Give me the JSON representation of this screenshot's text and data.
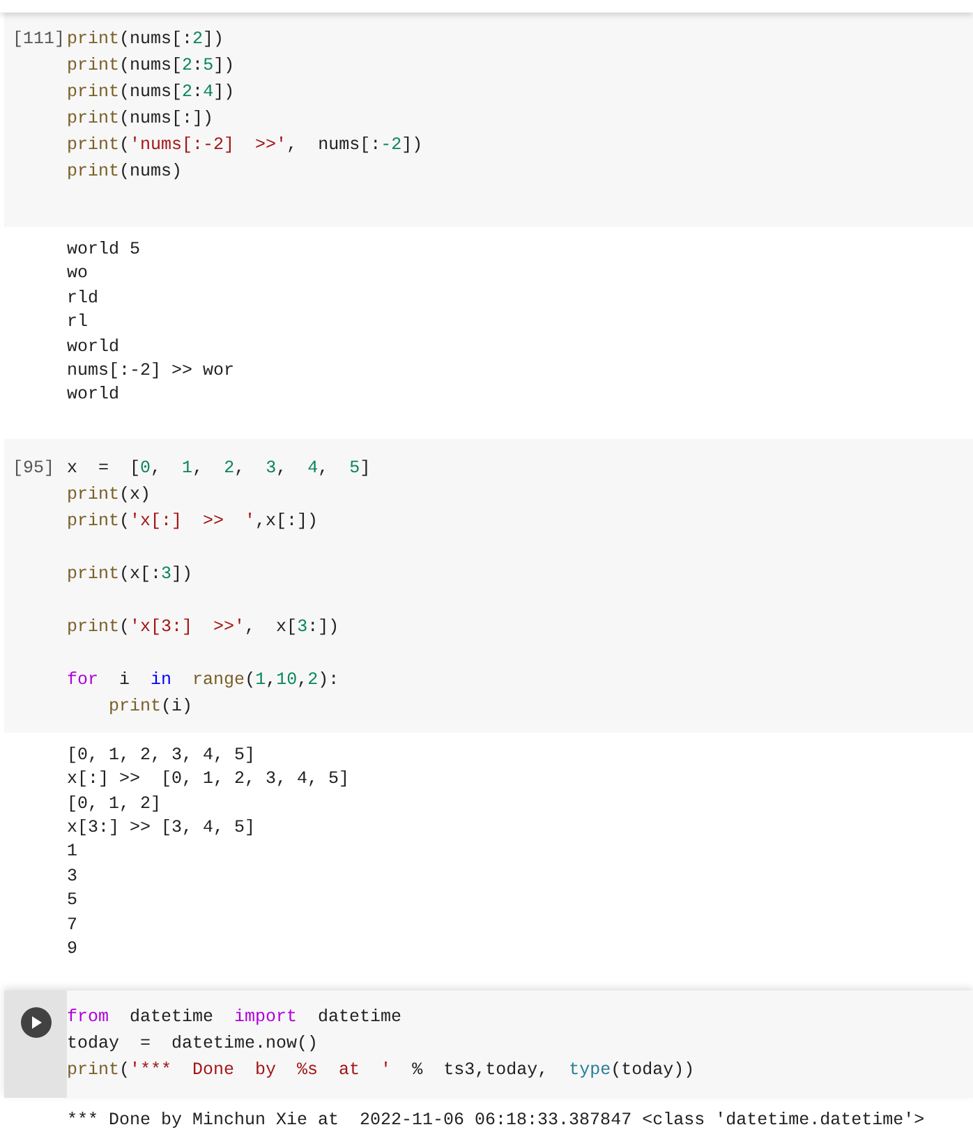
{
  "cells": [
    {
      "kind": "executed",
      "execution_count": "[111]",
      "lines": [
        {
          "tokens": [
            {
              "kind": "fn",
              "text": "print"
            },
            {
              "kind": "plain",
              "text": "(nums[:"
            },
            {
              "kind": "num",
              "text": "2"
            },
            {
              "kind": "plain",
              "text": "])"
            }
          ]
        },
        {
          "tokens": [
            {
              "kind": "fn",
              "text": "print"
            },
            {
              "kind": "plain",
              "text": "(nums["
            },
            {
              "kind": "num",
              "text": "2"
            },
            {
              "kind": "plain",
              "text": ":"
            },
            {
              "kind": "num",
              "text": "5"
            },
            {
              "kind": "plain",
              "text": "])"
            }
          ]
        },
        {
          "tokens": [
            {
              "kind": "fn",
              "text": "print"
            },
            {
              "kind": "plain",
              "text": "(nums["
            },
            {
              "kind": "num",
              "text": "2"
            },
            {
              "kind": "plain",
              "text": ":"
            },
            {
              "kind": "num",
              "text": "4"
            },
            {
              "kind": "plain",
              "text": "])"
            }
          ]
        },
        {
          "tokens": [
            {
              "kind": "fn",
              "text": "print"
            },
            {
              "kind": "plain",
              "text": "(nums[:])"
            }
          ]
        },
        {
          "tokens": [
            {
              "kind": "fn",
              "text": "print"
            },
            {
              "kind": "plain",
              "text": "("
            },
            {
              "kind": "str",
              "text": "'nums[:-2]  >>'"
            },
            {
              "kind": "plain",
              "text": ",  nums[:"
            },
            {
              "kind": "num",
              "text": "-2"
            },
            {
              "kind": "plain",
              "text": "])"
            }
          ]
        },
        {
          "tokens": [
            {
              "kind": "fn",
              "text": "print"
            },
            {
              "kind": "plain",
              "text": "(nums)"
            }
          ]
        }
      ],
      "output": [
        "world 5",
        "wo",
        "rld",
        "rl",
        "world",
        "nums[:-2] >> wor",
        "world"
      ]
    },
    {
      "kind": "executed",
      "execution_count": "[95]",
      "lines": [
        {
          "tokens": [
            {
              "kind": "plain",
              "text": "x  =  ["
            },
            {
              "kind": "num",
              "text": "0"
            },
            {
              "kind": "plain",
              "text": ",  "
            },
            {
              "kind": "num",
              "text": "1"
            },
            {
              "kind": "plain",
              "text": ",  "
            },
            {
              "kind": "num",
              "text": "2"
            },
            {
              "kind": "plain",
              "text": ",  "
            },
            {
              "kind": "num",
              "text": "3"
            },
            {
              "kind": "plain",
              "text": ",  "
            },
            {
              "kind": "num",
              "text": "4"
            },
            {
              "kind": "plain",
              "text": ",  "
            },
            {
              "kind": "num",
              "text": "5"
            },
            {
              "kind": "plain",
              "text": "]"
            }
          ]
        },
        {
          "tokens": [
            {
              "kind": "fn",
              "text": "print"
            },
            {
              "kind": "plain",
              "text": "(x)"
            }
          ]
        },
        {
          "tokens": [
            {
              "kind": "fn",
              "text": "print"
            },
            {
              "kind": "plain",
              "text": "("
            },
            {
              "kind": "str",
              "text": "'x[:]  >>  '"
            },
            {
              "kind": "plain",
              "text": ",x[:])"
            }
          ]
        },
        {
          "kind": "blank"
        },
        {
          "tokens": [
            {
              "kind": "fn",
              "text": "print"
            },
            {
              "kind": "plain",
              "text": "(x[:"
            },
            {
              "kind": "num",
              "text": "3"
            },
            {
              "kind": "plain",
              "text": "])"
            }
          ]
        },
        {
          "kind": "blank"
        },
        {
          "tokens": [
            {
              "kind": "fn",
              "text": "print"
            },
            {
              "kind": "plain",
              "text": "("
            },
            {
              "kind": "str",
              "text": "'x[3:]  >>'"
            },
            {
              "kind": "plain",
              "text": ",  x["
            },
            {
              "kind": "num",
              "text": "3"
            },
            {
              "kind": "plain",
              "text": ":])"
            }
          ]
        },
        {
          "kind": "blank"
        },
        {
          "tokens": [
            {
              "kind": "kw",
              "text": "for"
            },
            {
              "kind": "plain",
              "text": "  i  "
            },
            {
              "kind": "op",
              "text": "in"
            },
            {
              "kind": "fn",
              "text": "  range"
            },
            {
              "kind": "plain",
              "text": "("
            },
            {
              "kind": "num",
              "text": "1"
            },
            {
              "kind": "plain",
              "text": ","
            },
            {
              "kind": "num",
              "text": "10"
            },
            {
              "kind": "plain",
              "text": ","
            },
            {
              "kind": "num",
              "text": "2"
            },
            {
              "kind": "plain",
              "text": "):"
            }
          ]
        },
        {
          "tokens": [
            {
              "kind": "fn",
              "text": "    print"
            },
            {
              "kind": "plain",
              "text": "(i)"
            }
          ]
        }
      ],
      "output": [
        "[0, 1, 2, 3, 4, 5]",
        "x[:] >>  [0, 1, 2, 3, 4, 5]",
        "[0, 1, 2]",
        "x[3:] >> [3, 4, 5]",
        "1",
        "3",
        "5",
        "7",
        "9"
      ]
    },
    {
      "kind": "focused",
      "lines": [
        {
          "tokens": [
            {
              "kind": "kw",
              "text": "from"
            },
            {
              "kind": "plain",
              "text": "  datetime  "
            },
            {
              "kind": "kw",
              "text": "import"
            },
            {
              "kind": "plain",
              "text": "  datetime"
            }
          ]
        },
        {
          "tokens": [
            {
              "kind": "plain",
              "text": "today  =  datetime.now()"
            }
          ]
        },
        {
          "tokens": [
            {
              "kind": "fn",
              "text": "print"
            },
            {
              "kind": "plain",
              "text": "("
            },
            {
              "kind": "str",
              "text": "'***  Done  by  %s  at  '"
            },
            {
              "kind": "plain",
              "text": "  %  ts3,today,  "
            },
            {
              "kind": "builtin",
              "text": "type"
            },
            {
              "kind": "plain",
              "text": "(today))"
            }
          ]
        }
      ],
      "output": [
        "*** Done by Minchun Xie at  2022-11-06 06:18:33.387847 <class 'datetime.datetime'>"
      ]
    }
  ]
}
